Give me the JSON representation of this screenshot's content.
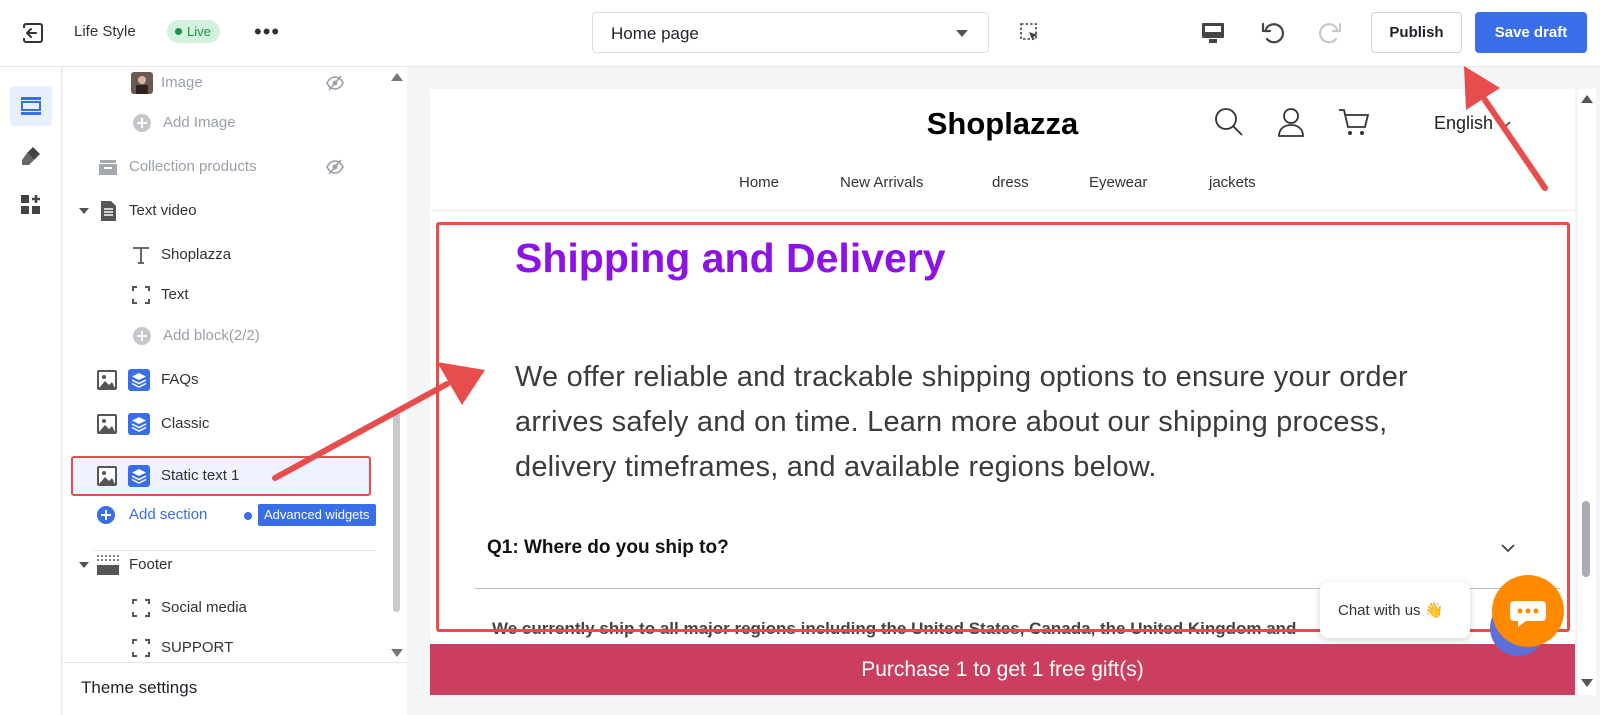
{
  "topbar": {
    "store_name": "Life Style",
    "status_badge": "Live",
    "more": "•••",
    "page_select": "Home page",
    "publish_label": "Publish",
    "save_label": "Save draft"
  },
  "sidebar": {
    "items": [
      {
        "label": "Image"
      },
      {
        "label": "Add Image"
      },
      {
        "label": "Collection products"
      },
      {
        "label": "Text video"
      },
      {
        "label": "Shoplazza"
      },
      {
        "label": "Text"
      },
      {
        "label": "Add block(2/2)"
      },
      {
        "label": "FAQs"
      },
      {
        "label": "Classic"
      },
      {
        "label": "Static text 1"
      },
      {
        "label": "Add section"
      },
      {
        "label": "Footer"
      },
      {
        "label": "Social media"
      },
      {
        "label": "SUPPORT"
      }
    ],
    "advanced_badge": "Advanced widgets",
    "theme_settings": "Theme settings"
  },
  "preview": {
    "logo": "Shoplazza",
    "language": "English",
    "nav": [
      "Home",
      "New Arrivals",
      "dress",
      "Eyewear",
      "jackets"
    ],
    "title": "Shipping and Delivery",
    "body": "We offer reliable and trackable shipping options to ensure your order arrives safely and on time. Learn more about our shipping process, delivery timeframes, and available regions below.",
    "question": "Q1: Where do you ship to?",
    "answer": "We currently ship to all major regions including the United States, Canada, the United Kingdom and",
    "promo": "Purchase 1 to get 1 free gift(s)",
    "chat": "Chat with us 👋"
  },
  "colors": {
    "accent": "#3a6de8",
    "title_purple": "#8c12e6",
    "promo": "#cc3e5f",
    "highlight": "#e84d4d",
    "chat": "#ff8a00"
  }
}
